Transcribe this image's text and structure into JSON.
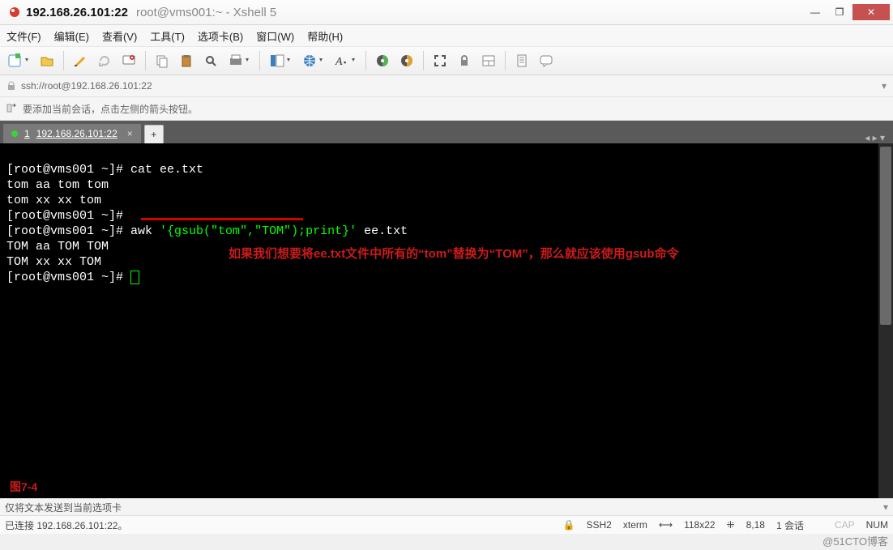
{
  "title": {
    "ip": "192.168.26.101:22",
    "sub": "root@vms001:~ - Xshell 5"
  },
  "winbtn": {
    "min": "—",
    "max": "❐",
    "close": "✕"
  },
  "menu": [
    "文件(F)",
    "编辑(E)",
    "查看(V)",
    "工具(T)",
    "选项卡(B)",
    "窗口(W)",
    "帮助(H)"
  ],
  "toolbar": {
    "new": "new-icon",
    "open": "open-icon",
    "edit": "edit-icon",
    "reconnect": "reconnect-icon",
    "disconnect": "disconnect-icon",
    "copy": "copy-icon",
    "paste": "paste-icon",
    "find": "find-icon",
    "print": "print-icon",
    "props": "props-icon",
    "lang": "lang-icon",
    "font": "font-icon",
    "color": "color-icon",
    "highlight": "highlight-icon",
    "fullscreen": "fullscreen-icon",
    "transparent": "transparent-icon",
    "sidebar": "sidebar-icon",
    "log": "log-icon",
    "help": "help-icon"
  },
  "address": {
    "url": "ssh://root@192.168.26.101:22"
  },
  "tip": {
    "text": "要添加当前会话，点击左侧的箭头按钮。"
  },
  "tab": {
    "num": "1",
    "label": "192.168.26.101:22",
    "add": "+",
    "x": "×",
    "arrows": "◂ ▸ ▾"
  },
  "terminal": {
    "p1": "[root@vms001 ~]# ",
    "cmd1": "cat ee.txt",
    "out1": "tom aa tom tom",
    "out2": "tom xx xx tom",
    "p2": "[root@vms001 ~]#",
    "p3": "[root@vms001 ~]# ",
    "cmd3a": "awk ",
    "cmd3b": "'{gsub(\"tom\",\"TOM\");print}'",
    "cmd3c": " ee.txt",
    "out3": "TOM aa TOM TOM",
    "out4": "TOM xx xx TOM",
    "p4": "[root@vms001 ~]# ",
    "annotation": "如果我们想要将ee.txt文件中所有的“tom”替换为“TOM”，那么就应该使用gsub命令",
    "figure": "图7-4"
  },
  "status": {
    "text": "仅将文本发送到当前选项卡"
  },
  "foot": {
    "conn": "已连接 192.168.26.101:22。",
    "proto": "SSH2",
    "term": "xterm",
    "size": "118x22",
    "pos": "8,18",
    "sess": "1 会话",
    "cap": "CAP",
    "num": "NUM",
    "sizeicon": "⟷",
    "posicon": "⁜",
    "lockicon": "🔒"
  },
  "watermark": "@51CTO博客"
}
